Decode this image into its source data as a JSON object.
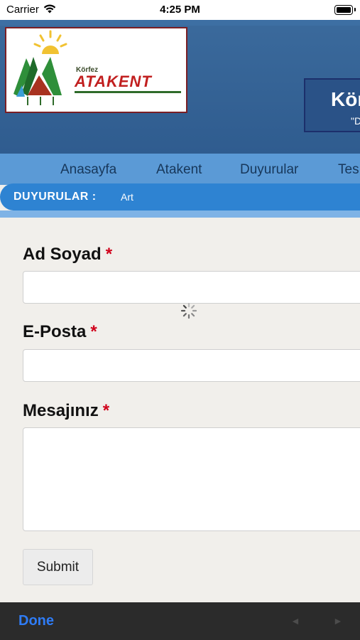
{
  "status_bar": {
    "carrier": "Carrier",
    "time": "4:25 PM"
  },
  "header": {
    "logo_small": "Körfez",
    "logo_name": "ATAKENT",
    "card_title": "Kör",
    "card_quote": "\"D"
  },
  "nav": {
    "items": [
      "Anasayfa",
      "Atakent",
      "Duyurular",
      "Tes"
    ]
  },
  "breadcrumb": {
    "label": "DUYURULAR :",
    "value": "Art"
  },
  "form": {
    "name_label": "Ad Soyad",
    "email_label": "E-Posta",
    "message_label": "Mesajınız",
    "required_mark": "*",
    "submit_label": "Submit"
  },
  "toolbar": {
    "done_label": "Done",
    "back_arrow": "◄",
    "forward_arrow": "►"
  },
  "colors": {
    "header_bg": "#2f5c8f",
    "nav_bg": "#5b9ad6",
    "breadcrumb_bg": "#2e83d2",
    "required": "#d0021b",
    "done": "#2f7cf6"
  }
}
